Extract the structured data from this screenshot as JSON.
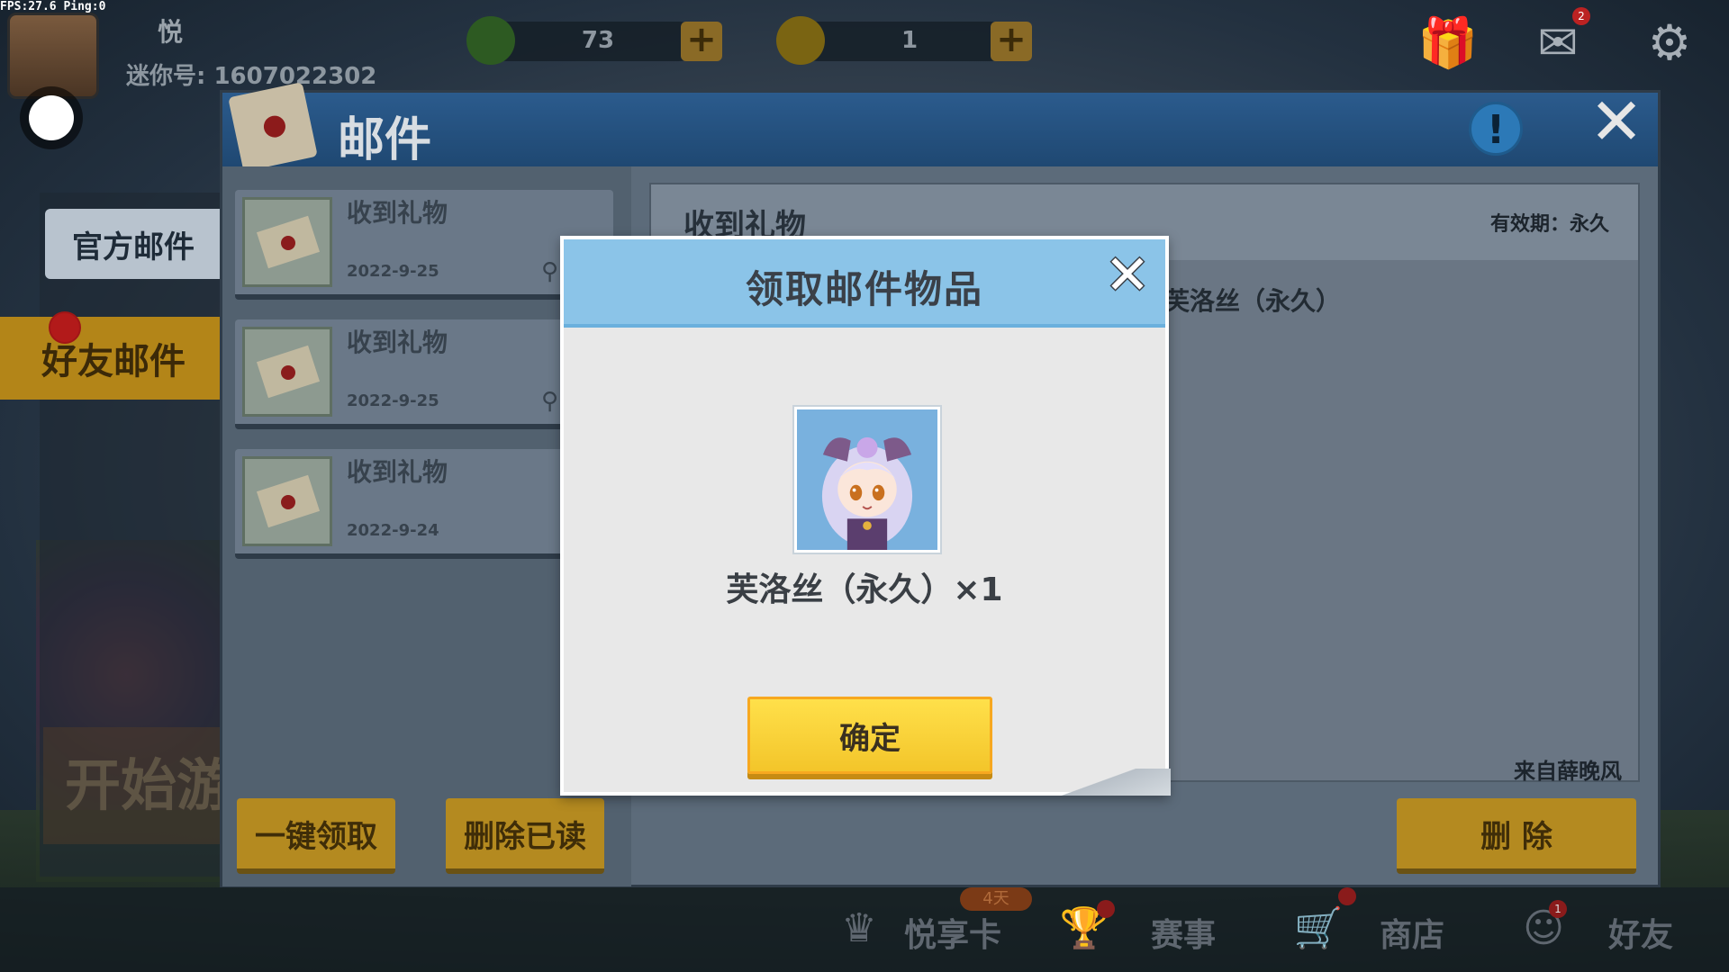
{
  "debug": {
    "fps_text": "FPS:27.6  Ping:0"
  },
  "hud": {
    "player_name": "悦",
    "player_id": "迷你号: 1607022302",
    "gems": "73",
    "coins": "1",
    "mail_badge": "2"
  },
  "side_menu": {
    "official_mail": "官方邮件",
    "friend_mail": "好友邮件",
    "start_game": "开始游"
  },
  "mail_window": {
    "title": "邮件",
    "info_icon": "!",
    "close_icon": "✕",
    "items": [
      {
        "title": "收到礼物",
        "date": "2022-9-25"
      },
      {
        "title": "收到礼物",
        "date": "2022-9-25"
      },
      {
        "title": "收到礼物",
        "date": "2022-9-24"
      }
    ],
    "claim_all": "一键领取",
    "delete_read": "删除已读",
    "delete": "删 除",
    "detail": {
      "title": "收到礼物",
      "validity": "有效期：永久",
      "body": "芙洛丝（永久）",
      "from": "来自薛晚风"
    }
  },
  "bottom_nav": {
    "vip_card": "悦享卡",
    "vip_tag": "4天",
    "events": "赛事",
    "shop": "商店",
    "friends": "好友",
    "friends_badge": "1"
  },
  "modal": {
    "title": "领取邮件物品",
    "close_icon": "✕",
    "reward_label": "芙洛丝（永久）×1",
    "confirm": "确定"
  },
  "colors": {
    "modal_header": "#8bc4e8",
    "confirm_button": "#f3c52a",
    "accent_gold": "#b48a20"
  }
}
